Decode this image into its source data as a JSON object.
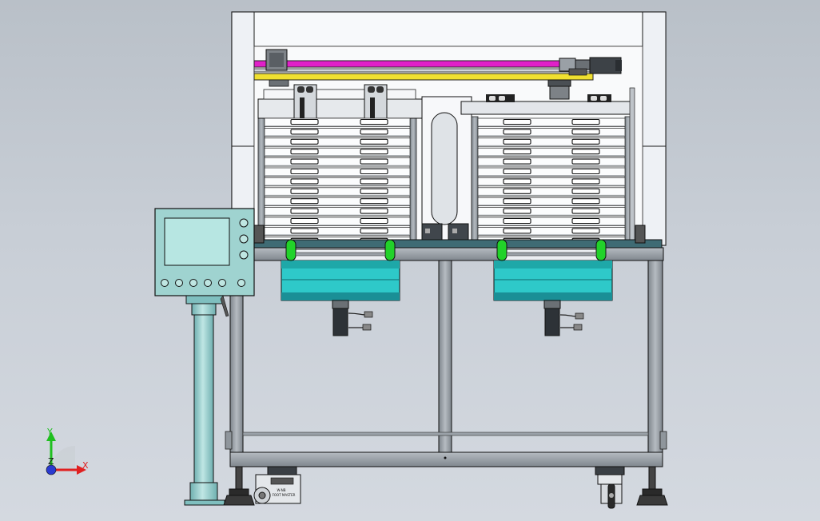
{
  "view": {
    "name": "cad-front-view",
    "colors": {
      "background_top": "#b9c0c8",
      "background_bottom": "#d4d9e0",
      "frame_steel": "#9aa1a8",
      "frame_outline": "#1a1a1a",
      "housing_white": "#f4f6f8",
      "rail_magenta": "#e020c8",
      "rail_yellow": "#f0e030",
      "tray_blue": "#2ec9c9",
      "roller_green": "#22d22a",
      "panel_teal": "#9fd3d0",
      "post_teal": "#8ec8c8"
    }
  },
  "hmi_panel": {
    "icon": "touchscreen-control-panel",
    "buttons_bottom_count": 6,
    "buttons_side_count": 3
  },
  "caster_left": {
    "label_line1": "W-NB",
    "label_line2": "FOOT MASTER"
  },
  "axis_triad": {
    "x_label": "X",
    "y_label": "Y",
    "z_label": "Z"
  }
}
